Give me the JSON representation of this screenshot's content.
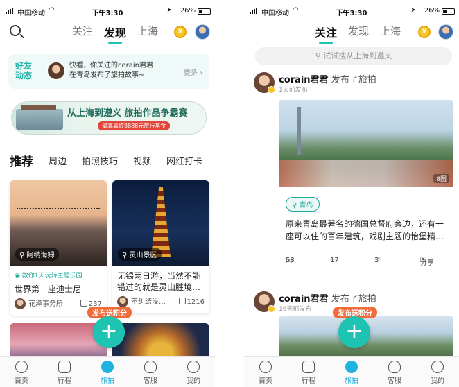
{
  "status_bar": {
    "carrier": "中国移动",
    "time": "下午3:30",
    "battery": "26%"
  },
  "top_nav": {
    "tabs": [
      "关注",
      "发现",
      "上海"
    ]
  },
  "left": {
    "friends_card": {
      "logo_line1": "好友",
      "logo_line2": "动态",
      "line1": "快看，你关注的corain君君",
      "line2": "在青岛发布了旅拍故事~",
      "more": "更多"
    },
    "banner": {
      "title": "从上海到遵义 旅拍作品争霸赛",
      "tag": "最高赢取8888元旅行基金"
    },
    "categories": [
      "推荐",
      "周边",
      "拍照技巧",
      "视频",
      "网红打卡"
    ],
    "cards": [
      {
        "location": "阿纳海姆",
        "theme": "教你1天玩转主题乐园",
        "title": "世界第一座迪士尼",
        "author": "花泽事务所",
        "likes": "237"
      },
      {
        "location": "灵山景区",
        "title": "无锡两日游，当然不能错过的就是灵山胜境…",
        "author": "不纠结没…",
        "likes": "1216"
      }
    ]
  },
  "fab": {
    "label": "发布送积分",
    "plus": "+"
  },
  "right": {
    "search_placeholder": "试试搜从上海到遵义",
    "posts": [
      {
        "author": "corain君君",
        "action": "发布了旅拍",
        "time": "1天前发布",
        "photo_count": "8图",
        "location": "青岛",
        "text": "原来青岛最著名的德国总督府旁边，还有一座可以住的百年建筑，戏剧主题的怡堡精…",
        "likes": "58",
        "comments": "17",
        "favorites": "3",
        "share": "分享"
      },
      {
        "author": "corain君君",
        "action": "发布了旅拍",
        "time": "16天前发布"
      }
    ]
  },
  "tab_bar": [
    "首页",
    "行程",
    "旅拍",
    "客服",
    "我的"
  ],
  "colors": {
    "accent": "#1fc3b1",
    "active_tab": "#1fb3e0",
    "fab_label": "#f26b3a"
  }
}
